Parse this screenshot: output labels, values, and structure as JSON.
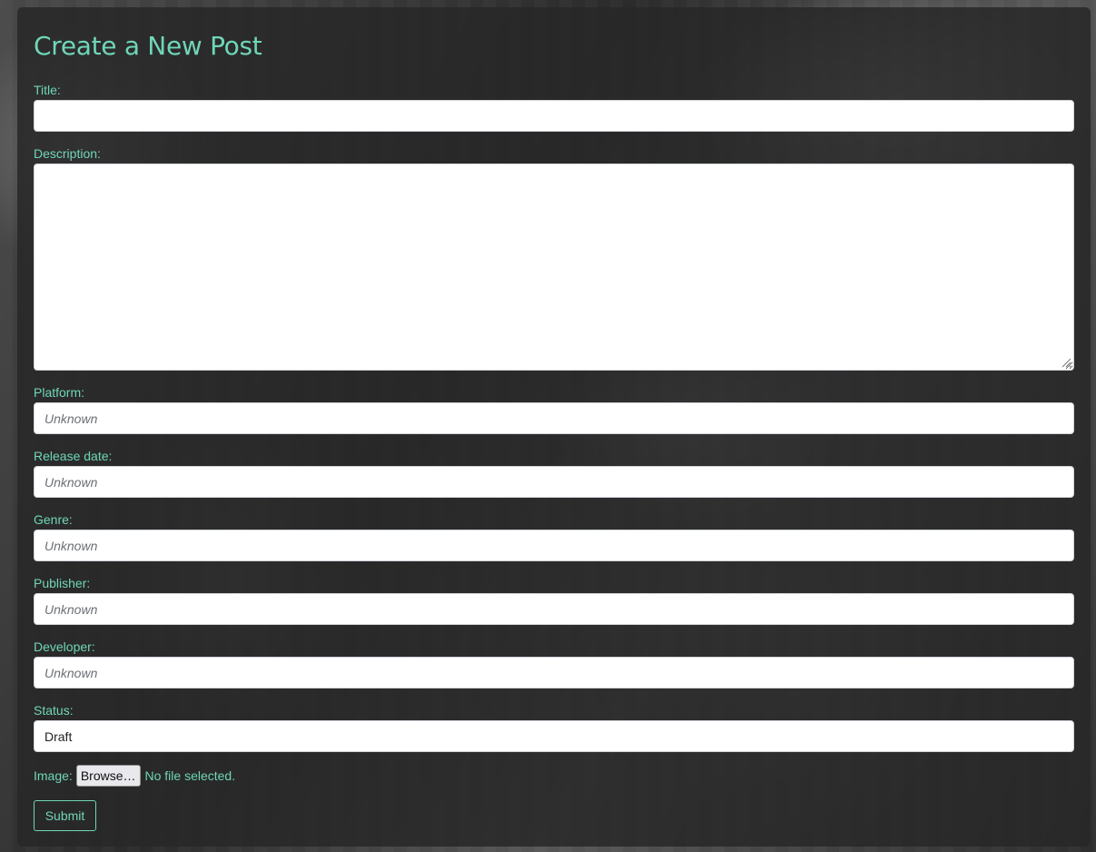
{
  "form": {
    "heading": "Create a New Post",
    "title": {
      "label": "Title:",
      "value": "",
      "placeholder": ""
    },
    "description": {
      "label": "Description:",
      "value": "",
      "placeholder": ""
    },
    "platform": {
      "label": "Platform:",
      "value": "",
      "placeholder": "Unknown"
    },
    "release_date": {
      "label": "Release date:",
      "value": "",
      "placeholder": "Unknown"
    },
    "genre": {
      "label": "Genre:",
      "value": "",
      "placeholder": "Unknown"
    },
    "publisher": {
      "label": "Publisher:",
      "value": "",
      "placeholder": "Unknown"
    },
    "developer": {
      "label": "Developer:",
      "value": "",
      "placeholder": "Unknown"
    },
    "status": {
      "label": "Status:",
      "value": "Draft"
    },
    "image": {
      "label": "Image:",
      "browse_label": "Browse…",
      "file_status": "No file selected."
    },
    "submit_label": "Submit"
  },
  "colors": {
    "accent": "#6fd6b8",
    "panel": "#282828",
    "input_bg": "#ffffff"
  }
}
